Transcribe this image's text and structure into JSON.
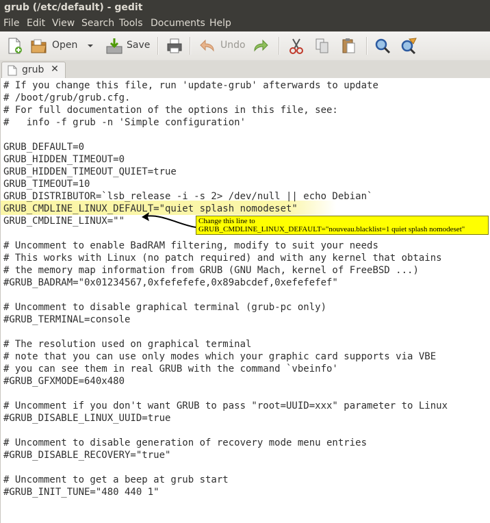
{
  "window": {
    "title": "grub (/etc/default) - gedit"
  },
  "menu": [
    "File",
    "Edit",
    "View",
    "Search",
    "Tools",
    "Documents",
    "Help"
  ],
  "toolbar": {
    "new_icon": "new-document-icon",
    "open_label": "Open",
    "save_label": "Save",
    "undo_label": "Undo"
  },
  "tab": {
    "label": "grub",
    "close": "✕"
  },
  "editor": {
    "lines": [
      "# If you change this file, run 'update-grub' afterwards to update",
      "# /boot/grub/grub.cfg.",
      "# For full documentation of the options in this file, see:",
      "#   info -f grub -n 'Simple configuration'",
      "",
      "GRUB_DEFAULT=0",
      "GRUB_HIDDEN_TIMEOUT=0",
      "GRUB_HIDDEN_TIMEOUT_QUIET=true",
      "GRUB_TIMEOUT=10",
      "GRUB_DISTRIBUTOR=`lsb_release -i -s 2> /dev/null || echo Debian`",
      "GRUB_CMDLINE_LINUX_DEFAULT=\"quiet splash nomodeset\"",
      "GRUB_CMDLINE_LINUX=\"\"",
      "",
      "# Uncomment to enable BadRAM filtering, modify to suit your needs",
      "# This works with Linux (no patch required) and with any kernel that obtains",
      "# the memory map information from GRUB (GNU Mach, kernel of FreeBSD ...)",
      "#GRUB_BADRAM=\"0x01234567,0xfefefefe,0x89abcdef,0xefefefef\"",
      "",
      "# Uncomment to disable graphical terminal (grub-pc only)",
      "#GRUB_TERMINAL=console",
      "",
      "# The resolution used on graphical terminal",
      "# note that you can use only modes which your graphic card supports via VBE",
      "# you can see them in real GRUB with the command `vbeinfo'",
      "#GRUB_GFXMODE=640x480",
      "",
      "# Uncomment if you don't want GRUB to pass \"root=UUID=xxx\" parameter to Linux",
      "#GRUB_DISABLE_LINUX_UUID=true",
      "",
      "# Uncomment to disable generation of recovery mode menu entries",
      "#GRUB_DISABLE_RECOVERY=\"true\"",
      "",
      "# Uncomment to get a beep at grub start",
      "#GRUB_INIT_TUNE=\"480 440 1\""
    ]
  },
  "annotation": {
    "line1": "Change this line to",
    "line2": "GRUB_CMDLINE_LINUX_DEFAULT=\"nouveau.blacklist=1 quiet splash nomodeset\"",
    "color": "#ffff00"
  },
  "colors": {
    "titlebar": "#3c3b37",
    "highlight": "#fbf6a8"
  }
}
